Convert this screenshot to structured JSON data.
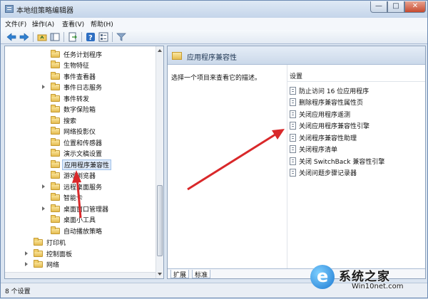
{
  "window": {
    "title": "本地组策略编辑器",
    "min_label": "—",
    "max_label": "□",
    "close_label": "✕"
  },
  "menu": [
    "文件(F)",
    "操作(A)",
    "查看(V)",
    "帮助(H)"
  ],
  "tree": {
    "items": [
      {
        "label": "任务计划程序",
        "expandable": false,
        "selected": false
      },
      {
        "label": "生物特征",
        "expandable": false,
        "selected": false
      },
      {
        "label": "事件查看器",
        "expandable": false,
        "selected": false
      },
      {
        "label": "事件日志服务",
        "expandable": true,
        "selected": false
      },
      {
        "label": "事件转发",
        "expandable": false,
        "selected": false
      },
      {
        "label": "数字保险箱",
        "expandable": false,
        "selected": false
      },
      {
        "label": "搜索",
        "expandable": false,
        "selected": false
      },
      {
        "label": "网络投影仪",
        "expandable": false,
        "selected": false
      },
      {
        "label": "位置和传感器",
        "expandable": false,
        "selected": false
      },
      {
        "label": "演示文稿设置",
        "expandable": false,
        "selected": false
      },
      {
        "label": "应用程序兼容性",
        "expandable": false,
        "selected": true
      },
      {
        "label": "游戏浏览器",
        "expandable": false,
        "selected": false
      },
      {
        "label": "远程桌面服务",
        "expandable": true,
        "selected": false
      },
      {
        "label": "智能卡",
        "expandable": false,
        "selected": false
      },
      {
        "label": "桌面窗口管理器",
        "expandable": true,
        "selected": false
      },
      {
        "label": "桌面小工具",
        "expandable": false,
        "selected": false
      },
      {
        "label": "自动播放策略",
        "expandable": false,
        "selected": false
      }
    ],
    "root_items": [
      {
        "label": "打印机",
        "expandable": false
      },
      {
        "label": "控制面板",
        "expandable": true
      },
      {
        "label": "网络",
        "expandable": true
      }
    ]
  },
  "right": {
    "header_title": "应用程序兼容性",
    "description": "选择一个项目来查看它的描述。",
    "settings_header": "设置",
    "settings": [
      "防止访问 16 位应用程序",
      "删除程序兼容性属性页",
      "关闭应用程序遥测",
      "关闭应用程序兼容性引擎",
      "关闭程序兼容性助理",
      "关闭程序清单",
      "关闭 SwitchBack 兼容性引擎",
      "关闭问题步骤记录器"
    ],
    "tabs": [
      "扩展",
      "标准"
    ]
  },
  "status": {
    "text": "8 个设置"
  },
  "watermark": {
    "title": "系统之家",
    "url": "Win10net.com"
  },
  "colors": {
    "arrow": "#d9282a",
    "selection": "#dce9f9",
    "title_gradient_top": "#dfe9f5"
  }
}
